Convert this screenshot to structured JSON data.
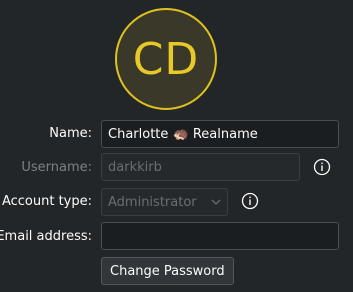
{
  "avatar": {
    "initials": "CD",
    "ring_color": "#e0c21d"
  },
  "form": {
    "name": {
      "label": "Name:",
      "value": "Charlotte 🦔 Realname"
    },
    "username": {
      "label": "Username:",
      "placeholder": "darkkirb",
      "info_icon": "info-icon"
    },
    "account_type": {
      "label": "Account type:",
      "selected": "Administrator",
      "info_icon": "info-icon"
    },
    "email": {
      "label": "Email address:",
      "value": ""
    },
    "change_password_label": "Change Password"
  }
}
